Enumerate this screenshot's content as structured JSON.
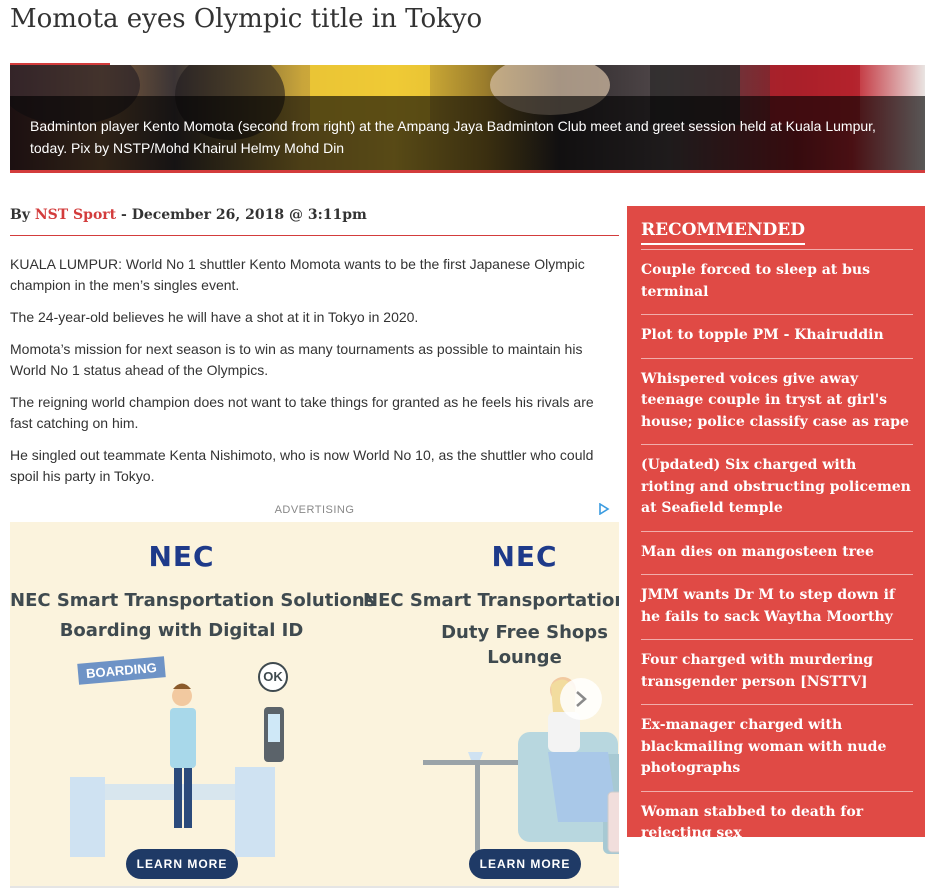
{
  "headline": "Momota eyes Olympic title in Tokyo",
  "hero": {
    "caption": "Badminton player Kento Momota (second from right) at the Ampang Jaya Badminton Club meet and greet session held at Kuala Lumpur, today. Pix by NSTP/Mohd Khairul Helmy Mohd Din"
  },
  "byline": {
    "prefix": "By",
    "author": "NST Sport",
    "separator": "-",
    "date": "December 26, 2018 @ 3:11pm"
  },
  "article": {
    "paragraphs": [
      "KUALA LUMPUR: World No 1 shuttler Kento Momota wants to be the first Japanese Olympic champion in the men’s singles event.",
      "The 24-year-old believes he will have a shot at it in Tokyo in 2020.",
      "Momota’s mission for next season is to win as many tournaments as possible to maintain his World No 1 status ahead of the Olympics.",
      "The reigning world champion does not want to take things for granted as he feels his rivals are fast catching on him.",
      "He singled out teammate Kenta Nishimoto, who is now World No 10, as the shuttler who could spoil his party in Tokyo."
    ]
  },
  "ad": {
    "label": "ADVERTISING",
    "choices_icon": "adchoices-icon",
    "panels": [
      {
        "brand": "NEC",
        "line1": "NEC Smart Transportation Solutions",
        "line2": "Boarding with Digital ID",
        "tag": "BOARDING",
        "bubble": "OK",
        "cta": "LEARN MORE"
      },
      {
        "brand": "NEC",
        "line1": "NEC Smart Transportation So",
        "line2": "Duty Free Shops",
        "line3": "Lounge",
        "cta": "LEARN MORE"
      }
    ],
    "next_icon": "chevron-right-icon"
  },
  "sidebar": {
    "title": "RECOMMENDED",
    "items": [
      "Couple forced to sleep at bus terminal",
      "Plot to topple PM - Khairuddin",
      "Whispered voices give away teenage couple in tryst at girl's house; police classify case as rape",
      "(Updated) Six charged with rioting and obstructing policemen at Seafield temple",
      "Man dies on mangosteen tree",
      "JMM wants Dr M to step down if he fails to sack Waytha Moorthy",
      "Four charged with murdering transgender person [NSTTV]",
      "Ex-manager charged with blackmailing woman with nude photographs",
      "Woman stabbed to death for rejecting sex"
    ]
  },
  "colors": {
    "accent": "#d33c3c",
    "sidebar_bg": "#e04a45",
    "nec_blue": "#1e3a8a"
  }
}
